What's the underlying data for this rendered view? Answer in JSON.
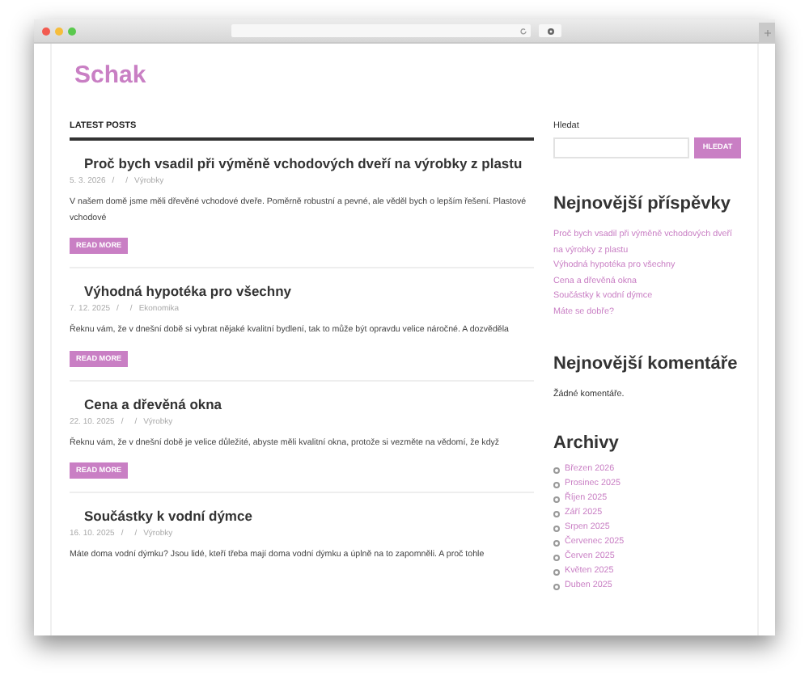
{
  "site_title": "Schak",
  "section_heading": "LATEST POSTS",
  "posts": [
    {
      "title": "Proč bych vsadil při výměně vchodových dveří na výrobky z plastu",
      "date": "5. 3. 2026",
      "separator_1": "/",
      "separator_2": "/",
      "category": "Výrobky",
      "excerpt": "V našem domě jsme měli dřevěné vchodové dveře. Poměrně robustní a pevné, ale věděl bych o lepším řešení. Plastové vchodové",
      "button": "READ MORE"
    },
    {
      "title": "Výhodná hypotéka pro všechny",
      "date": "7. 12. 2025",
      "separator_1": "/",
      "separator_2": "/",
      "category": "Ekonomika",
      "excerpt": "Řeknu vám, že v dnešní době si vybrat nějaké kvalitní bydlení, tak to může být opravdu velice náročné. A dozvěděla",
      "button": "READ MORE"
    },
    {
      "title": "Cena a dřevěná okna",
      "date": "22. 10. 2025",
      "separator_1": "/",
      "separator_2": "/",
      "category": "Výrobky",
      "excerpt": "Řeknu vám, že v dnešní době je velice důležité, abyste měli kvalitní okna, protože si vezměte na vědomí, že když",
      "button": "READ MORE"
    },
    {
      "title": "Součástky k vodní dýmce",
      "date": "16. 10. 2025",
      "separator_1": "/",
      "separator_2": "/",
      "category": "Výrobky",
      "excerpt": "Máte doma vodní dýmku? Jsou lidé, kteří třeba mají doma vodní dýmku a úplně na to zapomněli. A proč tohle"
    }
  ],
  "sidebar": {
    "search": {
      "label": "Hledat",
      "button": "HLEDAT"
    },
    "recent_posts": {
      "heading": "Nejnovější příspěvky",
      "items": [
        "Proč bych vsadil při výměně vchodových dveří na výrobky z plastu",
        "Výhodná hypotéka pro všechny",
        "Cena a dřevěná okna",
        "Součástky k vodní dýmce",
        "Máte se dobře?"
      ]
    },
    "recent_comments": {
      "heading": "Nejnovější komentáře",
      "text": "Žádné komentáře."
    },
    "archives": {
      "heading": "Archivy",
      "items": [
        "Březen 2026",
        "Prosinec 2025",
        "Říjen 2025",
        "Září 2025",
        "Srpen 2025",
        "Červenec 2025",
        "Červen 2025",
        "Květen 2025",
        "Duben 2025"
      ]
    }
  }
}
